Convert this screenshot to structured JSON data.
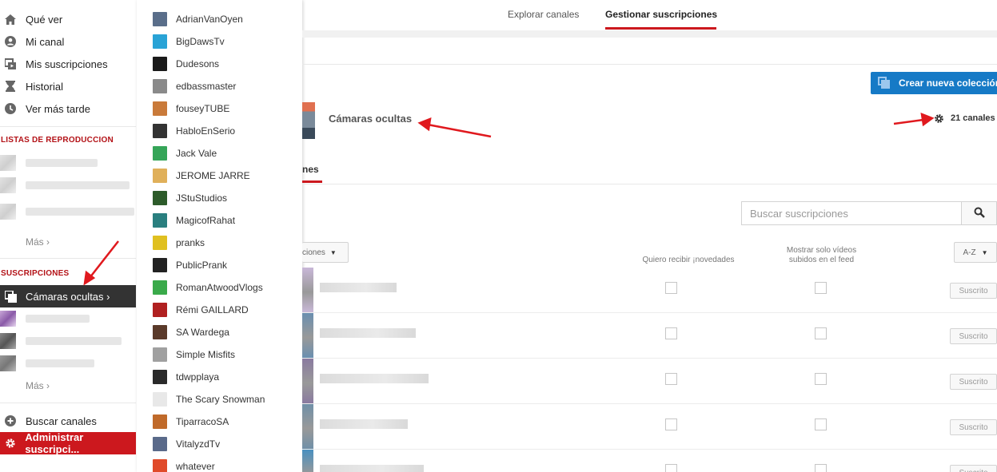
{
  "guide": {
    "nav": [
      {
        "label": "Qué ver",
        "icon": "home-icon"
      },
      {
        "label": "Mi canal",
        "icon": "user-icon"
      },
      {
        "label": "Mis suscripciones",
        "icon": "subscriptions-icon"
      },
      {
        "label": "Historial",
        "icon": "hourglass-icon"
      },
      {
        "label": "Ver más tarde",
        "icon": "clock-icon"
      }
    ],
    "playlists_title": "LISTAS DE REPRODUCCION",
    "more1": "Más ›",
    "subscriptions_title": "SUSCRIPCIONES",
    "active_collection": "Cámaras ocultas ›",
    "more2": "Más ›",
    "search_channels": "Buscar canales",
    "manage_subscriptions": "Administrar suscripci..."
  },
  "menu": {
    "channels": [
      {
        "name": "AdrianVanOyen",
        "color": "#5a6e8a"
      },
      {
        "name": "BigDawsTv",
        "color": "#29a3d6"
      },
      {
        "name": "Dudesons",
        "color": "#1a1a1a"
      },
      {
        "name": "edbassmaster",
        "color": "#8a8a8a"
      },
      {
        "name": "fouseyTUBE",
        "color": "#c97a3a"
      },
      {
        "name": "HabloEnSerio",
        "color": "#333333"
      },
      {
        "name": "Jack Vale",
        "color": "#35a558"
      },
      {
        "name": "JEROME JARRE",
        "color": "#e0b05a"
      },
      {
        "name": "JStuStudios",
        "color": "#2d5b2a"
      },
      {
        "name": "MagicofRahat",
        "color": "#2a7f7f"
      },
      {
        "name": "pranks",
        "color": "#e0c020"
      },
      {
        "name": "PublicPrank",
        "color": "#222222"
      },
      {
        "name": "RomanAtwoodVlogs",
        "color": "#3aaa4a"
      },
      {
        "name": "Rémi GAILLARD",
        "color": "#b02020"
      },
      {
        "name": "SA Wardega",
        "color": "#5a3a2a"
      },
      {
        "name": "Simple Misfits",
        "color": "#a0a0a0"
      },
      {
        "name": "tdwpplaya",
        "color": "#2a2a2a"
      },
      {
        "name": "The Scary Snowman",
        "color": "#e8e8e8"
      },
      {
        "name": "TiparracoSA",
        "color": "#c06a2a"
      },
      {
        "name": "VitalyzdTv",
        "color": "#5a6a8a"
      },
      {
        "name": "whatever",
        "color": "#e04a2a"
      }
    ]
  },
  "topnav": {
    "explore": "Explorar canales",
    "manage": "Gestionar suscripciones"
  },
  "collection": {
    "title": "Cámaras ocultas",
    "count": "21 canales",
    "new_button": "Crear nueva colección",
    "tab_partial": "nes"
  },
  "search": {
    "placeholder": "Buscar suscripciones"
  },
  "table": {
    "sort_partial": "ciones",
    "col_updates": "Quiero recibir ¡novedades",
    "col_uploads": "Mostrar solo vídeos subidos en el feed",
    "az": "A-Z",
    "subscribed_label": "Suscrito",
    "rows": [
      {
        "thumb": "#c9b8d8"
      },
      {
        "thumb": "#6a8fb0"
      },
      {
        "thumb": "#8a7aa0"
      },
      {
        "thumb": "#7090a8"
      },
      {
        "thumb": "#4a90c0"
      }
    ]
  },
  "colors": {
    "accent": "#cc181e",
    "blue": "#167ac6",
    "arrow": "#e0191e"
  }
}
